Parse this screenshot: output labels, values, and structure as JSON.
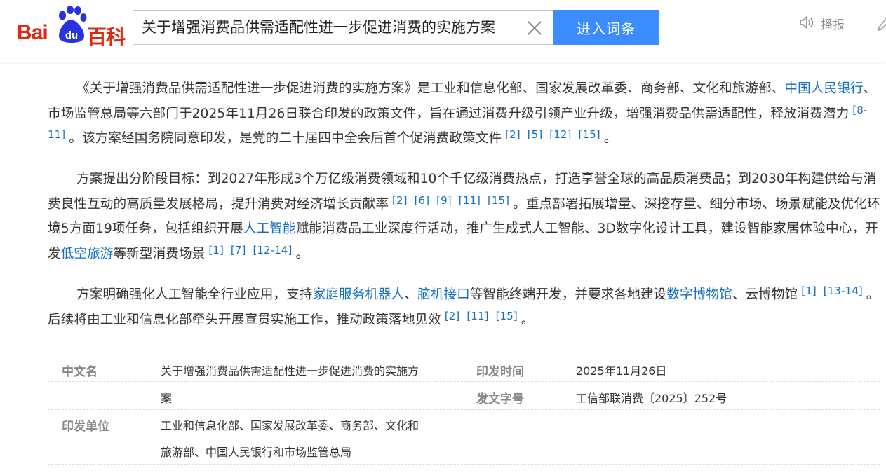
{
  "header": {
    "logo_text_left": "Bai",
    "logo_text_middle": "du",
    "logo_text_right": "百科",
    "search_value": "关于增强消费品供需适配性进一步促进消费的实施方案",
    "enter_button_label": "进入词条",
    "play_label": "播报",
    "icons": {
      "clear": "close-icon",
      "speaker": "speaker-icon",
      "edit": "edit-icon",
      "logo": "baidu-paw-icon"
    },
    "colors": {
      "brand_red": "#de2910",
      "brand_blue": "#2932e1",
      "button_blue": "#3a8cff",
      "link_blue": "#136ec2"
    }
  },
  "article": {
    "p1": {
      "t1": "《关于增强消费品供需适配性进一步促进消费的实施方案》是工业和信息化部、国家发展改革委、商务部、文化和旅游部、",
      "link1": "中国人民银行",
      "t2": "、市场监管总局等六部门于2025年11月26日联合印发的政策文件，旨在通过消费升级引领产业升级，增强消费品供需适配性，释放消费潜力",
      "ref1": "[8-11]",
      "t3": "。该方案经国务院同意印发，是党的二十届四中全会后首个促消费政策文件",
      "ref2": "[2]",
      "ref3": "[5]",
      "ref4": "[12]",
      "ref5": "[15]",
      "t4": "。"
    },
    "p2": {
      "t1": "方案提出分阶段目标：到2027年形成3个万亿级消费领域和10个千亿级消费热点，打造享誉全球的高品质消费品；到2030年构建供给与消费良性互动的高质量发展格局，提升消费对经济增长贡献率",
      "ref1": "[2]",
      "ref2": "[6]",
      "ref3": "[9]",
      "ref4": "[11]",
      "ref5": "[15]",
      "t2": "。重点部署拓展增量、深挖存量、细分市场、场景赋能及优化环境5方面19项任务，包括组织开展",
      "link1": "人工智能",
      "t3": "赋能消费品工业深度行活动，推广生成式人工智能、3D数字化设计工具，建设智能家居体验中心，开发",
      "link2": "低空旅游",
      "t4": "等新型消费场景",
      "ref6": "[1]",
      "ref7": "[7]",
      "ref8": "[12-14]",
      "t5": "。"
    },
    "p3": {
      "t1": "方案明确强化人工智能全行业应用，支持",
      "link1": "家庭服务机器人",
      "t2": "、",
      "link2": "脑机接口",
      "t3": "等智能终端开发，并要求各地建设",
      "link3": "数字博物馆",
      "t4": "、云博物馆",
      "ref1": "[1]",
      "ref2": "[13-14]",
      "t5": "。后续将由工业和信息化部牵头开展宣贯实施工作，推动政策落地见效",
      "ref3": "[2]",
      "ref4": "[11]",
      "ref5": "[15]",
      "t6": "。"
    }
  },
  "info": {
    "name_label": "中文名",
    "name_value_line1": "关于增强消费品供需适配性进一步促进消费的实施方",
    "name_value_line2": "案",
    "date_label": "印发时间",
    "date_value": "2025年11月26日",
    "doc_no_label": "发文字号",
    "doc_no_value": "工信部联消费〔2025〕252号",
    "issuer_label": "印发单位",
    "issuer_value_line1": "工业和信息化部、国家发展改革委、商务部、文化和",
    "issuer_value_line2": "旅游部、中国人民银行和市场监管总局"
  }
}
